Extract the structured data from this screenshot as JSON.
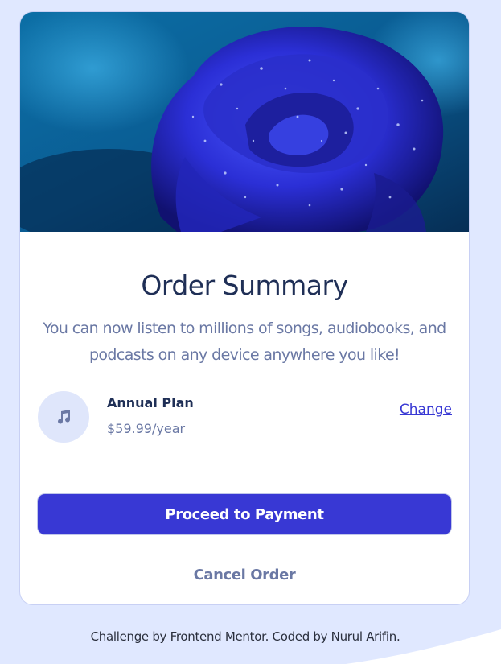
{
  "colors": {
    "page_background": "#E0E8FF",
    "card_background": "#FFFFFF",
    "primary": "#3838D4",
    "title": "#1F2F56",
    "muted_text": "#6A78A4",
    "icon_circle": "#DFE6FB"
  },
  "hero": {
    "icon": "blue-rose-photo"
  },
  "card": {
    "title": "Order Summary",
    "description": "You can now listen to millions of songs, audiobooks, and podcasts on any device anywhere you like!"
  },
  "plan": {
    "icon": "music-note-icon",
    "name": "Annual Plan",
    "price": "$59.99/year",
    "change_label": "Change"
  },
  "actions": {
    "proceed_label": "Proceed to Payment",
    "cancel_label": "Cancel Order"
  },
  "footer": {
    "text": "Challenge by Frontend Mentor. Coded by Nurul Arifin."
  }
}
